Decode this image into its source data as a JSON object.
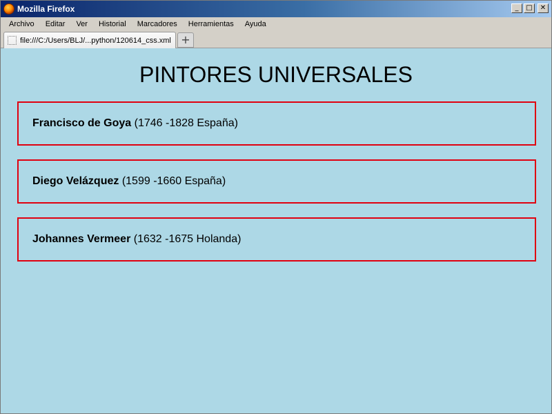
{
  "window": {
    "title": "Mozilla Firefox"
  },
  "window_buttons": {
    "minimize": "_",
    "maximize": "□",
    "close": "✕"
  },
  "menubar": {
    "items": [
      "Archivo",
      "Editar",
      "Ver",
      "Historial",
      "Marcadores",
      "Herramientas",
      "Ayuda"
    ]
  },
  "tab": {
    "label": "file:///C:/Users/BLJ/...python/120614_css.xml",
    "new_tab": "+"
  },
  "page": {
    "heading": "PINTORES UNIVERSALES",
    "painters": [
      {
        "name": "Francisco de Goya",
        "details": "(1746 -1828 España)"
      },
      {
        "name": "Diego Velázquez",
        "details": "(1599 -1660 España)"
      },
      {
        "name": "Johannes Vermeer",
        "details": "(1632 -1675 Holanda)"
      }
    ]
  },
  "colors": {
    "page_background": "#add8e6",
    "box_border": "#e0000f",
    "titlebar": "#0a246a"
  },
  "icons": {
    "app": "firefox-icon",
    "tab": "page-icon"
  }
}
